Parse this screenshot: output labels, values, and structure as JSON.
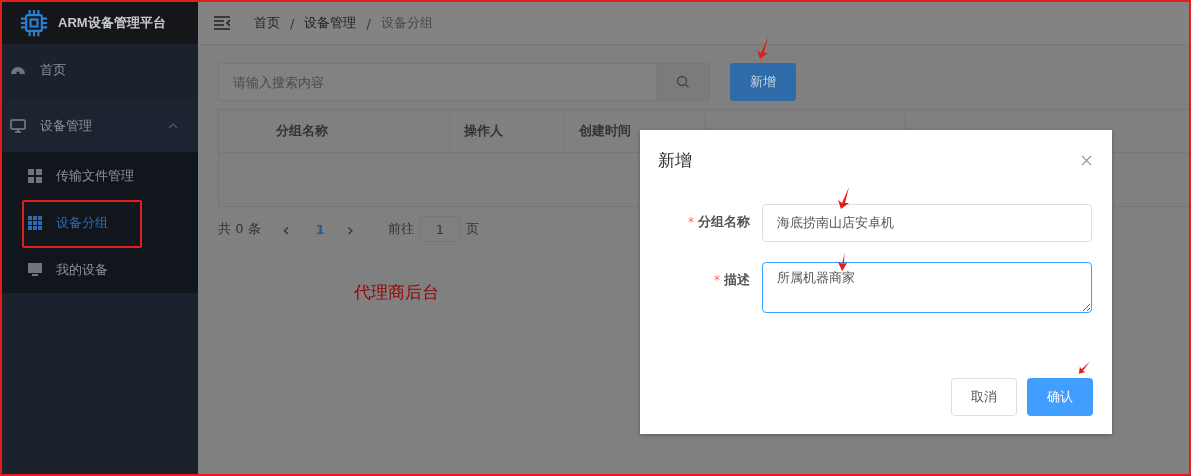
{
  "sidebar": {
    "logo_text": "ARM设备管理平台",
    "items": [
      {
        "label": "首页",
        "kind": "dashboard",
        "selected": false
      },
      {
        "label": "设备管理",
        "kind": "monitor",
        "selected": false,
        "expanded": true,
        "children": [
          {
            "label": "传输文件管理",
            "kind": "tiles",
            "selected": false
          },
          {
            "label": "设备分组",
            "kind": "grid",
            "selected": true
          },
          {
            "label": "我的设备",
            "kind": "screen",
            "selected": false
          }
        ]
      }
    ]
  },
  "breadcrumb_separator": "/",
  "breadcrumb": [
    {
      "label": "首页",
      "current": false
    },
    {
      "label": "设备管理",
      "current": false
    },
    {
      "label": "设备分组",
      "current": true
    }
  ],
  "search": {
    "placeholder": "请输入搜索内容"
  },
  "add_button": "新增",
  "table": {
    "columns": [
      "分组名称",
      "操作人",
      "创建时间"
    ]
  },
  "pagination": {
    "total": "共 0 条",
    "prev": "‹",
    "page": "1",
    "next": "›",
    "goto_label": "前往",
    "goto_value": "1",
    "unit": "页"
  },
  "dialog": {
    "title": "新增",
    "required_mark": "*",
    "fields": [
      {
        "label": "分组名称",
        "required": true,
        "kind": "input",
        "value": "海底捞南山店安卓机",
        "focused": false
      },
      {
        "label": "描述",
        "required": true,
        "kind": "textarea",
        "value": "所属机器商家",
        "focused": true
      }
    ],
    "cancel": "取消",
    "confirm": "确认"
  },
  "annotation": "代理商后台"
}
